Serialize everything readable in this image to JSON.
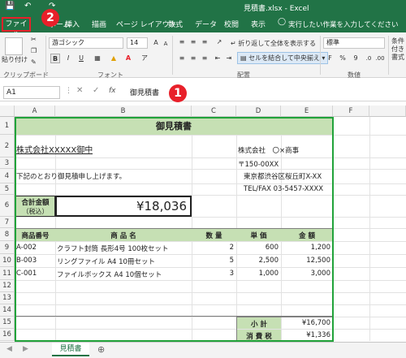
{
  "titlebar": {
    "filename": "見積書.xlsx",
    "app": "Excel",
    "save_icon": "save-icon",
    "undo_icon": "undo-icon",
    "redo_icon": "redo-icon"
  },
  "ribbon_tabs": [
    "ファイル",
    "ホーム",
    "挿入",
    "描画",
    "ページ レイアウト",
    "数式",
    "データ",
    "校閲",
    "表示"
  ],
  "tell_me": "実行したい作業を入力してください",
  "ribbon": {
    "paste": "貼り付け",
    "clipboard_group": "クリップボード",
    "font_name": "游ゴシック",
    "font_size": "14",
    "grow": "A",
    "shrink": "A",
    "bold": "B",
    "italic": "I",
    "underline": "U",
    "font_group": "フォント",
    "wrap_text": "折り返して全体を表示する",
    "merge_center": "セルを結合して中央揃え",
    "alignment_group": "配置",
    "number_format": "標準",
    "currency": "%",
    "comma": "9",
    "number_group": "数値",
    "conditional": "条件付き書式"
  },
  "formula_bar": {
    "name_box": "A1",
    "fx": "fx",
    "content": "御見積書"
  },
  "markers": {
    "m1": "1",
    "m2": "2"
  },
  "columns": [
    "A",
    "B",
    "C",
    "D",
    "E",
    "F"
  ],
  "rows": [
    "1",
    "2",
    "3",
    "4",
    "5",
    "6",
    "7",
    "8",
    "9",
    "10",
    "11",
    "12",
    "13",
    "14",
    "15",
    "16"
  ],
  "sheet": {
    "title": "御見積書",
    "customer": "株式会社XXXXX御中",
    "company": "株式会社　〇×商事",
    "postal": "〒150-00XX",
    "address": "東京都渋谷区桜丘町X-XX",
    "telfax": "TEL/FAX 03-5457-XXXX",
    "greeting": "下記のとおり御見積申し上げます。",
    "total_label": "合計金額",
    "total_tax_note": "（税込）",
    "total_value": "¥18,036",
    "table_headers": [
      "商品番号",
      "商 品 名",
      "数 量",
      "単 価",
      "金 額"
    ],
    "items": [
      {
        "code": "A-002",
        "name": "クラフト封筒 長形4号 100枚セット",
        "qty": "2",
        "price": "600",
        "amount": "1,200"
      },
      {
        "code": "B-003",
        "name": "リングファイル A4 10冊セット",
        "qty": "5",
        "price": "2,500",
        "amount": "12,500"
      },
      {
        "code": "C-001",
        "name": "ファイルボックス A4 10個セット",
        "qty": "3",
        "price": "1,000",
        "amount": "3,000"
      }
    ],
    "subtotal_label": "小 計",
    "subtotal_value": "¥16,700",
    "tax_label": "消 費 税",
    "tax_value": "¥1,336"
  },
  "sheet_tabs": [
    "見積書"
  ],
  "add_sheet": "⊕"
}
